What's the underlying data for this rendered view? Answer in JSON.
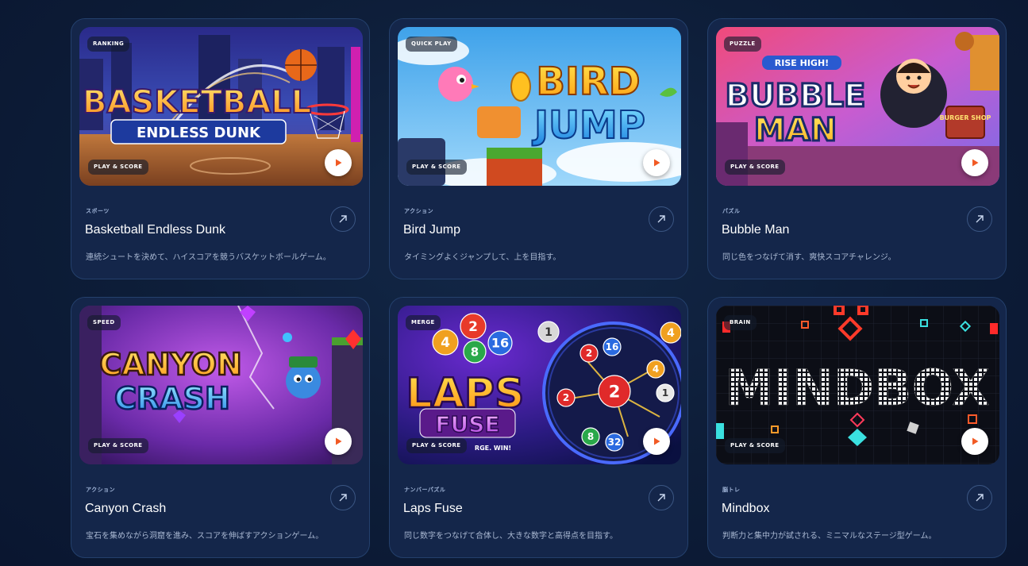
{
  "games": [
    {
      "id": "basketball",
      "badge_top": "RANKING",
      "badge_bottom": "PLAY & SCORE",
      "category": "スポーツ",
      "title": "Basketball Endless Dunk",
      "description": "連続シュートを決めて、ハイスコアを競うバスケットボールゲーム。",
      "logo_line1": "BASKETBALL",
      "logo_line2": "ENDLESS DUNK"
    },
    {
      "id": "birdjump",
      "badge_top": "QUICK PLAY",
      "badge_bottom": "PLAY & SCORE",
      "category": "アクション",
      "title": "Bird Jump",
      "description": "タイミングよくジャンプして、上を目指す。",
      "logo_line1": "BIRD",
      "logo_line2": "JUMP"
    },
    {
      "id": "bubbleman",
      "badge_top": "PUZZLE",
      "badge_bottom": "PLAY & SCORE",
      "category": "パズル",
      "title": "Bubble Man",
      "description": "同じ色をつなげて消す、爽快スコアチャレンジ。",
      "logo_tag": "RISE HIGH!",
      "logo_line1": "BUBBLE",
      "logo_line2": "MAN",
      "shop_sign": "BURGER SHOP"
    },
    {
      "id": "canyoncrash",
      "badge_top": "SPEED",
      "badge_bottom": "PLAY & SCORE",
      "category": "アクション",
      "title": "Canyon Crash",
      "description": "宝石を集めながら洞窟を進み、スコアを伸ばすアクションゲーム。",
      "logo_line1": "CANYON",
      "logo_line2": "CRASH"
    },
    {
      "id": "lapsfuse",
      "badge_top": "MERGE",
      "badge_bottom": "PLAY & SCORE",
      "category": "ナンバーパズル",
      "title": "Laps Fuse",
      "description": "同じ数字をつなげて合体し、大きな数字と高得点を目指す。",
      "logo_line1": "LAPS",
      "logo_line2": "FUSE",
      "logo_tag": "RGE. WIN!",
      "balls": [
        "2",
        "4",
        "8",
        "16",
        "1",
        "2",
        "16",
        "4",
        "1",
        "2",
        "2",
        "8",
        "32",
        "4"
      ]
    },
    {
      "id": "mindbox",
      "badge_top": "BRAIN",
      "badge_bottom": "PLAY & SCORE",
      "category": "脳トレ",
      "title": "Mindbox",
      "description": "判断力と集中力が試される、ミニマルなステージ型ゲーム。",
      "logo_line1": "MINDBOX"
    }
  ],
  "colors": {
    "page_bg": "#0d1d38",
    "card_bg": "#14264a",
    "card_border": "#24406c",
    "play_accent": "#f15a24",
    "title_text": "#ffffff",
    "muted_text": "#a9b8d2"
  },
  "icons": {
    "play": "play-icon",
    "open": "arrow-up-right-icon"
  }
}
